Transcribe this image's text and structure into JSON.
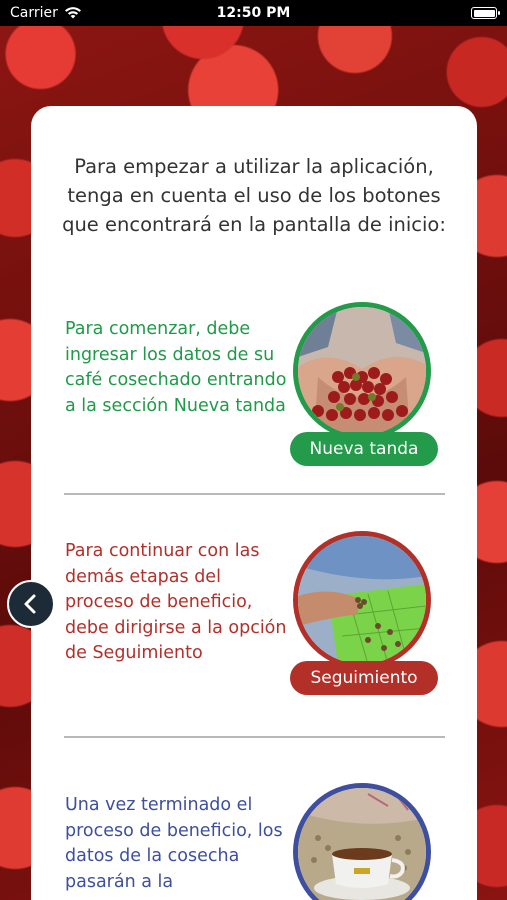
{
  "status_bar": {
    "carrier": "Carrier",
    "time": "12:50 PM"
  },
  "intro_text": "Para empezar a utilizar la aplicación, tenga en cuenta el uso de los botones que encontrará en la pantalla de inicio:",
  "sections": [
    {
      "text": "Para comenzar, debe ingresar los datos de su café cosechado entrando a la sección Nueva tanda",
      "button_label": "Nueva tanda",
      "color": "#239b4a",
      "image_icon": "coffee-cherries-in-hands"
    },
    {
      "text": "Para continuar con las demás etapas del proceso de beneficio, debe dirigirse a la opción de Seguimiento",
      "button_label": "Seguimiento",
      "color": "#b33029",
      "image_icon": "coffee-beans-sorting"
    },
    {
      "text": "Una vez terminado el proceso de beneficio, los datos de la cosecha pasarán a la",
      "color": "#3d4f9e",
      "image_icon": "coffee-cup-on-beans"
    }
  ],
  "navigation": {
    "back_icon": "chevron-left-icon"
  }
}
